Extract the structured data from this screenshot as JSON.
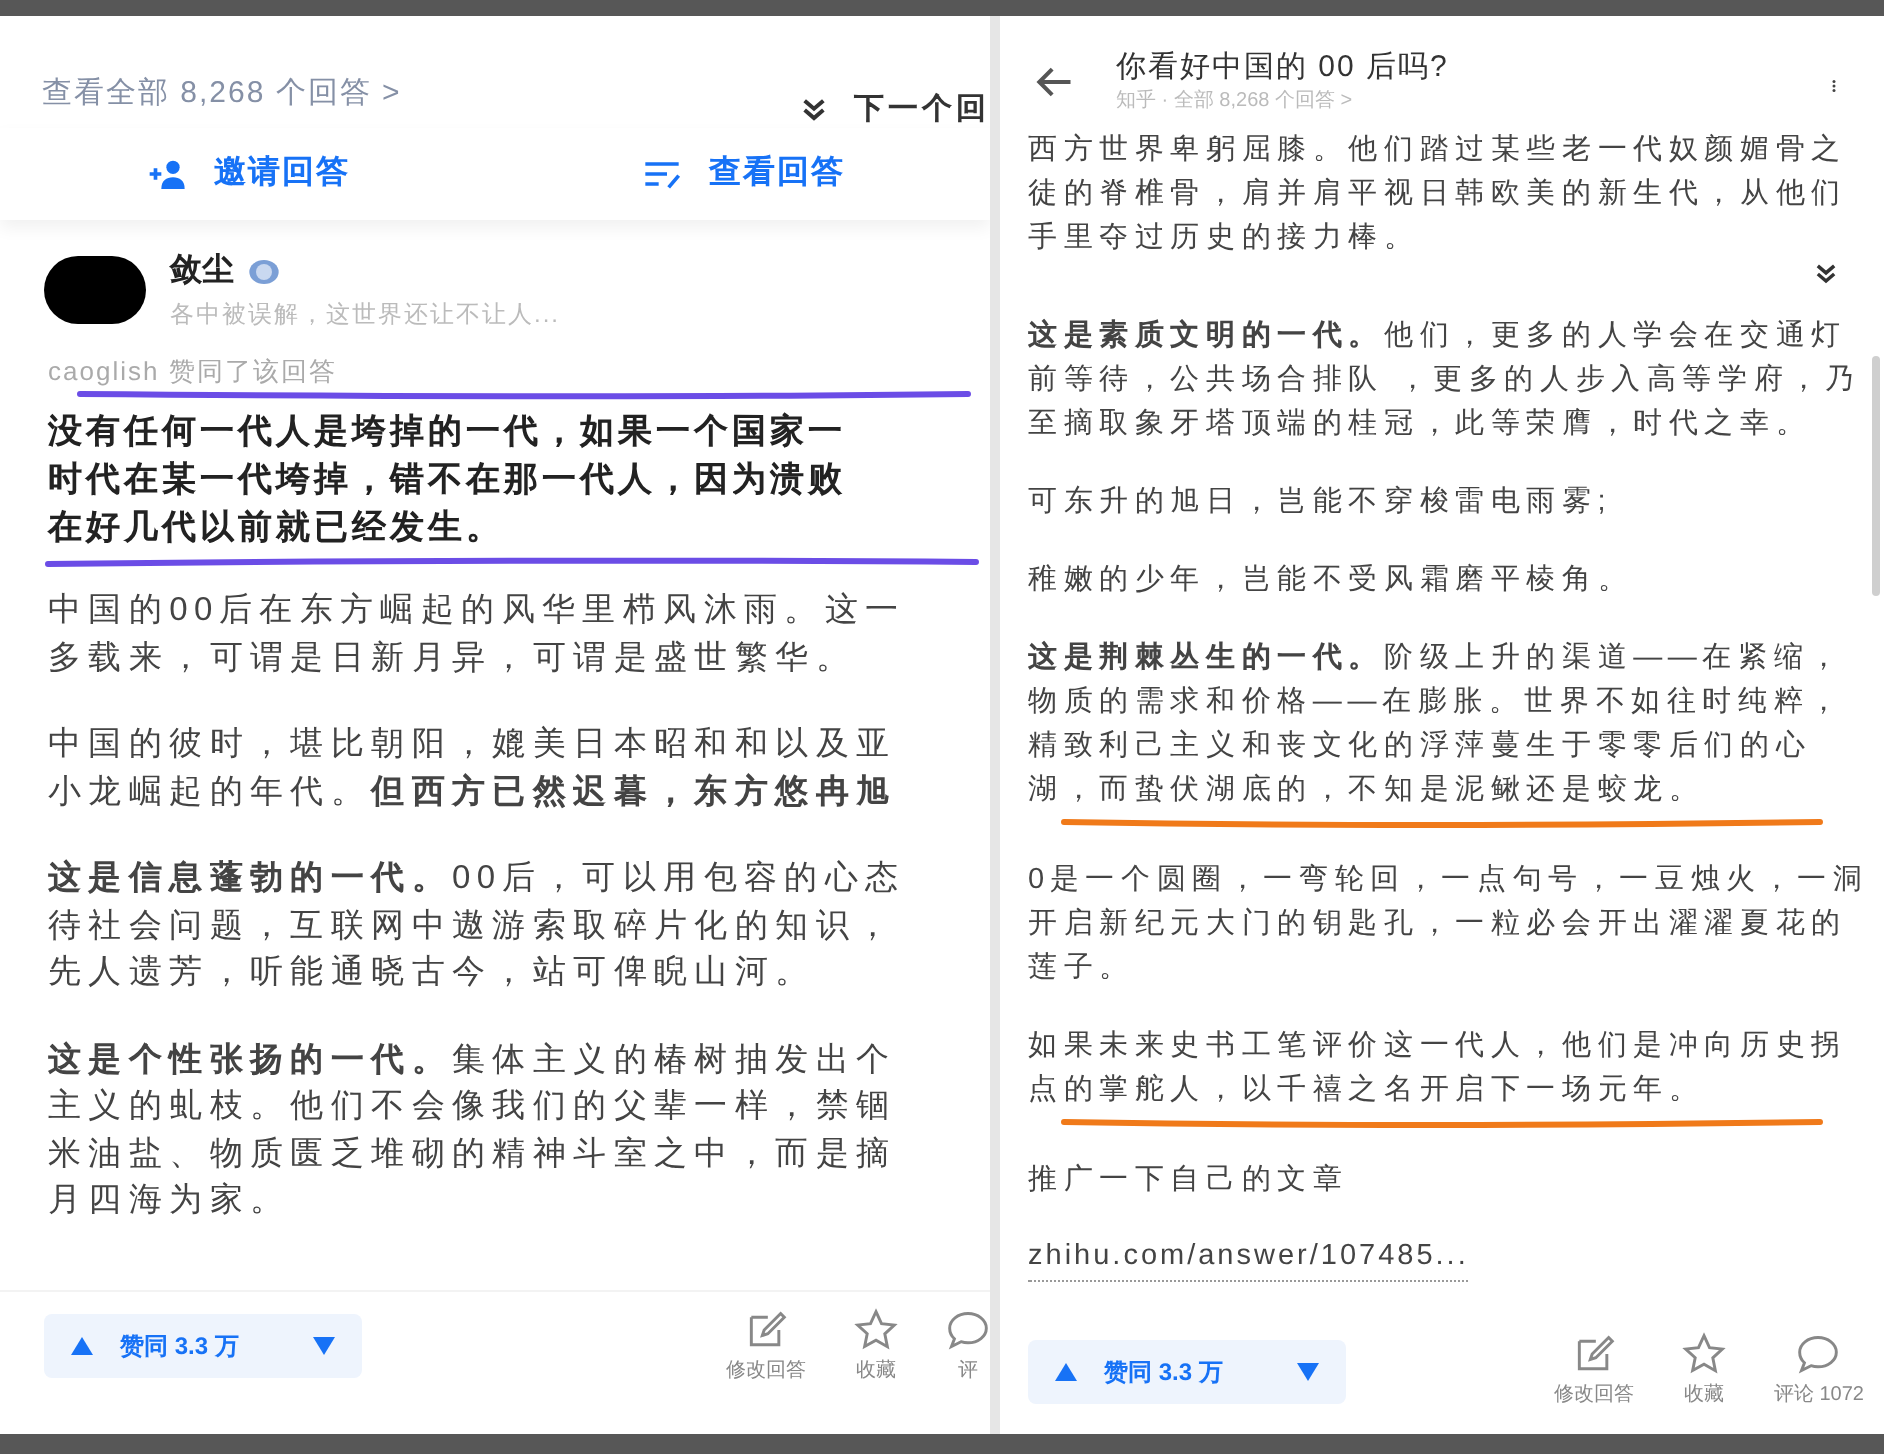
{
  "left_panel": {
    "all_answers": "查看全部 8,268 个回答 >",
    "next_answer": "下一个回",
    "actions": [
      {
        "kind": "invite",
        "label": "邀请回答"
      },
      {
        "kind": "sort",
        "label": "查看回答"
      }
    ],
    "author": {
      "name": "敛尘",
      "bio": "各中被误解，这世界还让不让人..."
    },
    "upvoted_by": {
      "text": "caoglish 赞同了该回答",
      "underlined": true
    },
    "lead": {
      "underlined": true,
      "lines": [
        "没有任何一代人是垮掉的一代，如果一个国家一",
        "时代在某一代垮掉，错不在那一代人，因为溃败",
        "在好几代以前就已经发生。"
      ]
    },
    "paragraphs": [
      {
        "lines": [
          "中国的00后在东方崛起的风华里栉风沐雨。这一",
          "多载来，可谓是日新月异，可谓是盛世繁华。"
        ]
      },
      {
        "lines": [
          "中国的彼时，堪比朝阳，媲美日本昭和和以及亚",
          "小龙崛起的年代。**但西方已然迟暮，东方悠冉旭**"
        ]
      },
      {
        "lines": [
          "**这是信息蓬勃的一代。**00后，可以用包容的心态",
          "待社会问题，互联网中遨游索取碎片化的知识，",
          "先人遗芳，听能通晓古今，站可俾睨山河。"
        ]
      },
      {
        "lines": [
          "**这是个性张扬的一代。**集体主义的椿树抽发出个",
          "主义的虬枝。他们不会像我们的父辈一样，禁锢",
          "米油盐、物质匮乏堆砌的精神斗室之中，而是摘",
          "月四海为家。"
        ]
      }
    ],
    "vote": "赞同 3.3 万",
    "toolbar": [
      {
        "kind": "edit",
        "label": "修改回答"
      },
      {
        "kind": "star",
        "label": "收藏"
      },
      {
        "kind": "comment",
        "label": "评"
      }
    ]
  },
  "right_panel": {
    "title": "你看好中国的 00 后吗?",
    "subtitle": "知乎 · 全部 8,268 个回答 >",
    "paragraphs": [
      {
        "text": "西方世界卑躬屈膝。他们踏过某些老一代奴颜媚骨之徒的脊椎骨，肩并肩平视日韩欧美的新生代，从他们手里夺过历史的接力棒。",
        "underlined": false
      },
      {
        "text": "**这是素质文明的一代。**他们，更多的人学会在交通灯前等待，公共场合排队 ，更多的人步入高等学府，乃至摘取象牙塔顶端的桂冠，此等荣膺，时代之幸。",
        "underlined": false
      },
      {
        "text": "可东升的旭日，岂能不穿梭雷电雨雾;",
        "underlined": false
      },
      {
        "text": "稚嫩的少年，岂能不受风霜磨平棱角。",
        "underlined": false
      },
      {
        "text": "**这是荆棘丛生的一代。**阶级上升的渠道——在紧缩，物质的需求和价格——在膨胀。世界不如往时纯粹，精致利己主义和丧文化的浮萍蔓生于零零后们的心湖，而蛰伏湖底的，不知是泥鳅还是蛟龙。",
        "underlined": true
      },
      {
        "text": "0是一个圆圈，一弯轮回，一点句号，一豆烛火，一洞开启新纪元大门的钥匙孔，一粒必会开出濯濯夏花的莲子。",
        "underlined": false
      },
      {
        "text": "如果未来史书工笔评价这一代人，他们是冲向历史拐点的掌舵人，以千禧之名开启下一场元年。",
        "underlined": true
      },
      {
        "text": "推广一下自己的文章",
        "underlined": false
      }
    ],
    "link": "zhihu.com/answer/107485...",
    "vote": "赞同 3.3 万",
    "toolbar": [
      {
        "kind": "edit",
        "label": "修改回答"
      },
      {
        "kind": "star",
        "label": "收藏"
      },
      {
        "kind": "comment",
        "label": "评论 1072"
      }
    ]
  }
}
